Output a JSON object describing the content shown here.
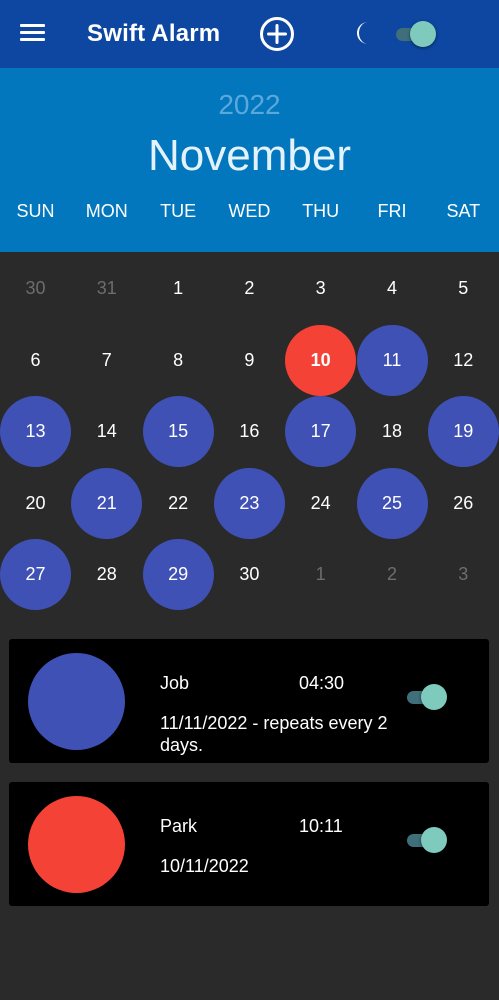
{
  "app": {
    "title": "Swift Alarm",
    "dark_mode_on": true
  },
  "icons": {
    "menu": "hamburger-menu-icon",
    "add": "plus-circle-icon",
    "theme": "moon-icon"
  },
  "colors": {
    "appbar": "#0d47a1",
    "header": "#0277bd",
    "background": "#2a2a2a",
    "alarm_day": "#3f51b5",
    "today": "#f44336",
    "toggle_knob": "#7ecbbe"
  },
  "calendar": {
    "year": "2022",
    "month": "November",
    "weekdays": [
      "SUN",
      "MON",
      "TUE",
      "WED",
      "THU",
      "FRI",
      "SAT"
    ],
    "weeks": [
      [
        {
          "d": "30",
          "m": true
        },
        {
          "d": "31",
          "m": true
        },
        {
          "d": "1"
        },
        {
          "d": "2"
        },
        {
          "d": "3"
        },
        {
          "d": "4"
        },
        {
          "d": "5"
        }
      ],
      [
        {
          "d": "6"
        },
        {
          "d": "7"
        },
        {
          "d": "8"
        },
        {
          "d": "9"
        },
        {
          "d": "10",
          "today": true
        },
        {
          "d": "11",
          "alarm": true
        },
        {
          "d": "12"
        }
      ],
      [
        {
          "d": "13",
          "alarm": true
        },
        {
          "d": "14"
        },
        {
          "d": "15",
          "alarm": true
        },
        {
          "d": "16"
        },
        {
          "d": "17",
          "alarm": true
        },
        {
          "d": "18"
        },
        {
          "d": "19",
          "alarm": true
        }
      ],
      [
        {
          "d": "20"
        },
        {
          "d": "21",
          "alarm": true
        },
        {
          "d": "22"
        },
        {
          "d": "23",
          "alarm": true
        },
        {
          "d": "24"
        },
        {
          "d": "25",
          "alarm": true
        },
        {
          "d": "26"
        }
      ],
      [
        {
          "d": "27",
          "alarm": true
        },
        {
          "d": "28"
        },
        {
          "d": "29",
          "alarm": true
        },
        {
          "d": "30"
        },
        {
          "d": "1",
          "m": true
        },
        {
          "d": "2",
          "m": true
        },
        {
          "d": "3",
          "m": true
        }
      ]
    ]
  },
  "alarms": [
    {
      "name": "Job",
      "time": "04:30",
      "detail": "11/11/2022 - repeats every 2 days.",
      "color": "#3f51b5",
      "enabled": true
    },
    {
      "name": "Park",
      "time": "10:11",
      "detail": "10/11/2022",
      "color": "#f44336",
      "enabled": true
    }
  ]
}
